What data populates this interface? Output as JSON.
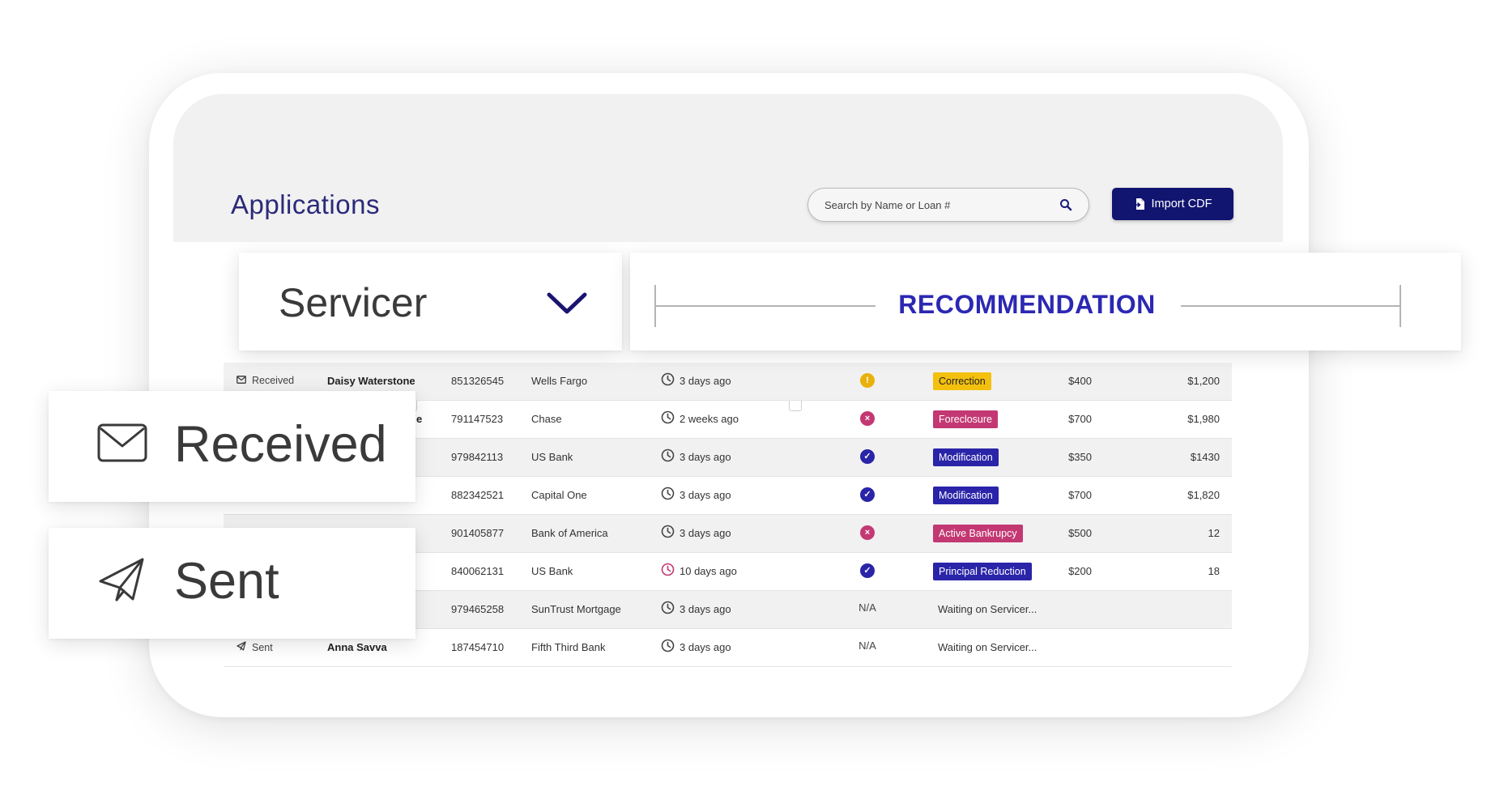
{
  "app": {
    "title": "Applications"
  },
  "search": {
    "placeholder": "Search by Name or Loan #"
  },
  "import": {
    "label": "Import CDF"
  },
  "cards": {
    "servicer": "Servicer",
    "recommendation": "RECOMMENDATION",
    "received": "Received",
    "sent": "Sent"
  },
  "colors": {
    "navy": "#111570",
    "blue_badge": "#2a24a8",
    "pink_badge": "#c33873",
    "yellow_badge": "#f3c00e",
    "check": "#2a24a8",
    "cross": "#c33873",
    "warn": "#e8b10d"
  },
  "rows": [
    {
      "status": "Received",
      "status_icon": "envelope-icon",
      "name": "Daisy Waterstone",
      "loan": "851326545",
      "servicer": "Wells Fargo",
      "time": "3 days ago",
      "time_alert": false,
      "indicator": "warning",
      "recommendation": "Correction",
      "rec_color": "yellow",
      "amount1": "$400",
      "amount2": "$1,200"
    },
    {
      "status": "",
      "status_icon": "",
      "name": "",
      "name_tail": "e",
      "loan": "791147523",
      "servicer": "Chase",
      "time": "2 weeks ago",
      "time_alert": false,
      "indicator": "cross",
      "recommendation": "Foreclosure",
      "rec_color": "pink",
      "amount1": "$700",
      "amount2": "$1,980"
    },
    {
      "status": "",
      "status_icon": "",
      "name": "",
      "loan": "979842113",
      "servicer": "US Bank",
      "time": "3 days ago",
      "time_alert": false,
      "indicator": "check",
      "recommendation": "Modification",
      "rec_color": "blue",
      "amount1": "$350",
      "amount2": "$1430"
    },
    {
      "status": "",
      "status_icon": "",
      "name": "",
      "loan": "882342521",
      "servicer": "Capital One",
      "time": "3 days ago",
      "time_alert": false,
      "indicator": "check",
      "recommendation": "Modification",
      "rec_color": "blue",
      "amount1": "$700",
      "amount2": "$1,820"
    },
    {
      "status": "",
      "status_icon": "",
      "name": "",
      "loan": "901405877",
      "servicer": "Bank of America",
      "time": "3 days ago",
      "time_alert": false,
      "indicator": "cross",
      "recommendation": "Active Bankrupcy",
      "rec_color": "pink",
      "amount1": "$500",
      "amount2": "12"
    },
    {
      "status": "",
      "status_icon": "",
      "name": "",
      "loan": "840062131",
      "servicer": "US Bank",
      "time": "10 days ago",
      "time_alert": true,
      "indicator": "check",
      "recommendation": "Principal Reduction",
      "rec_color": "blue",
      "amount1": "$200",
      "amount2": "18"
    },
    {
      "status": "",
      "status_icon": "",
      "name": "",
      "loan": "979465258",
      "servicer": "SunTrust Mortgage",
      "time": "3 days ago",
      "time_alert": false,
      "indicator": "N/A",
      "recommendation": "Waiting on Servicer...",
      "rec_color": "",
      "amount1": "",
      "amount2": ""
    },
    {
      "status": "Sent",
      "status_icon": "paper-plane-icon",
      "name": "Anna Savva",
      "loan": "187454710",
      "servicer": "Fifth Third Bank",
      "time": "3 days ago",
      "time_alert": false,
      "indicator": "N/A",
      "recommendation": "Waiting on Servicer...",
      "rec_color": "",
      "amount1": "",
      "amount2": ""
    }
  ]
}
